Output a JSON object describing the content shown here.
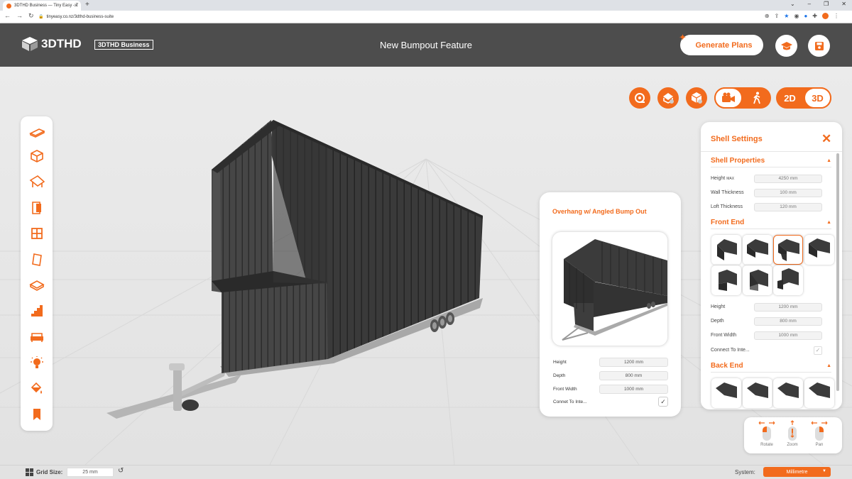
{
  "browser": {
    "tab_title": "3DTHD Business — Tiny Easy - T",
    "tab_close": "✕",
    "new_tab": "+",
    "url": "tinyeasy.co.nz/3dthd-business-suite",
    "window_controls": [
      "⌄",
      "–",
      "❐",
      "✕"
    ]
  },
  "header": {
    "logo_text": "3DTHD",
    "badge": "3DTHD Business",
    "title": "New Bumpout Feature",
    "generate_label": "Generate Plans",
    "icons": [
      "graduation-cap-icon",
      "save-icon"
    ]
  },
  "view_controls": {
    "dim_2d": "2D",
    "dim_3d": "3D",
    "active_dim": "3D"
  },
  "preview": {
    "title": "Overhang w/ Angled Bump Out",
    "fields": [
      {
        "label": "Height",
        "value": "1200 mm"
      },
      {
        "label": "Depth",
        "value": "800 mm"
      },
      {
        "label": "Front Width",
        "value": "1000 mm"
      }
    ],
    "checkbox_label": "Connet To Inte...",
    "checkbox_checked": true
  },
  "shell_settings": {
    "title": "Shell Settings",
    "close": "✕",
    "shell_properties": {
      "title": "Shell Properties",
      "height_label": "Height",
      "height_suffix": "MAX",
      "height_value": "4250 mm",
      "wall_label": "Wall Thickness",
      "wall_value": "100 mm",
      "loft_label": "Loft Thickness",
      "loft_value": "120 mm"
    },
    "front_end": {
      "title": "Front End",
      "selected_index": 2,
      "fields": [
        {
          "label": "Height",
          "value": "1200 mm"
        },
        {
          "label": "Depth",
          "value": "800 mm"
        },
        {
          "label": "Front Width",
          "value": "1000 mm"
        }
      ],
      "connect_label": "Connect To Inte...",
      "connect_checked": true
    },
    "back_end": {
      "title": "Back End"
    }
  },
  "mouse_help": {
    "rotate": "Rotate",
    "zoom": "Zoom",
    "pan": "Pan"
  },
  "bottom_bar": {
    "grid_label": "Grid Size:",
    "grid_value": "25 mm",
    "system_label": "System:",
    "system_value": "Millimetre"
  },
  "colors": {
    "accent": "#f26b1d",
    "header_bg": "#4d4d4d",
    "model": "#3d3d3d",
    "trailer": "#a8a8a8"
  }
}
